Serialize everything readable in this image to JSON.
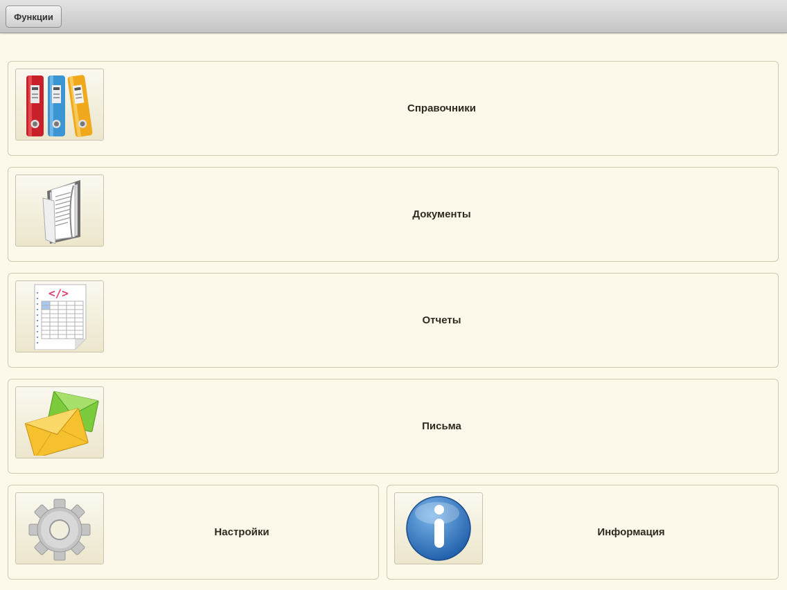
{
  "topbar": {
    "functions_label": "Функции"
  },
  "tiles": [
    {
      "label": "Справочники",
      "icon": "folders-icon"
    },
    {
      "label": "Документы",
      "icon": "documents-folder-icon"
    },
    {
      "label": "Отчеты",
      "icon": "report-spreadsheet-icon"
    },
    {
      "label": "Письма",
      "icon": "envelopes-icon"
    },
    {
      "label": "Настройки",
      "icon": "gear-icon"
    },
    {
      "label": "Информация",
      "icon": "info-icon"
    }
  ]
}
